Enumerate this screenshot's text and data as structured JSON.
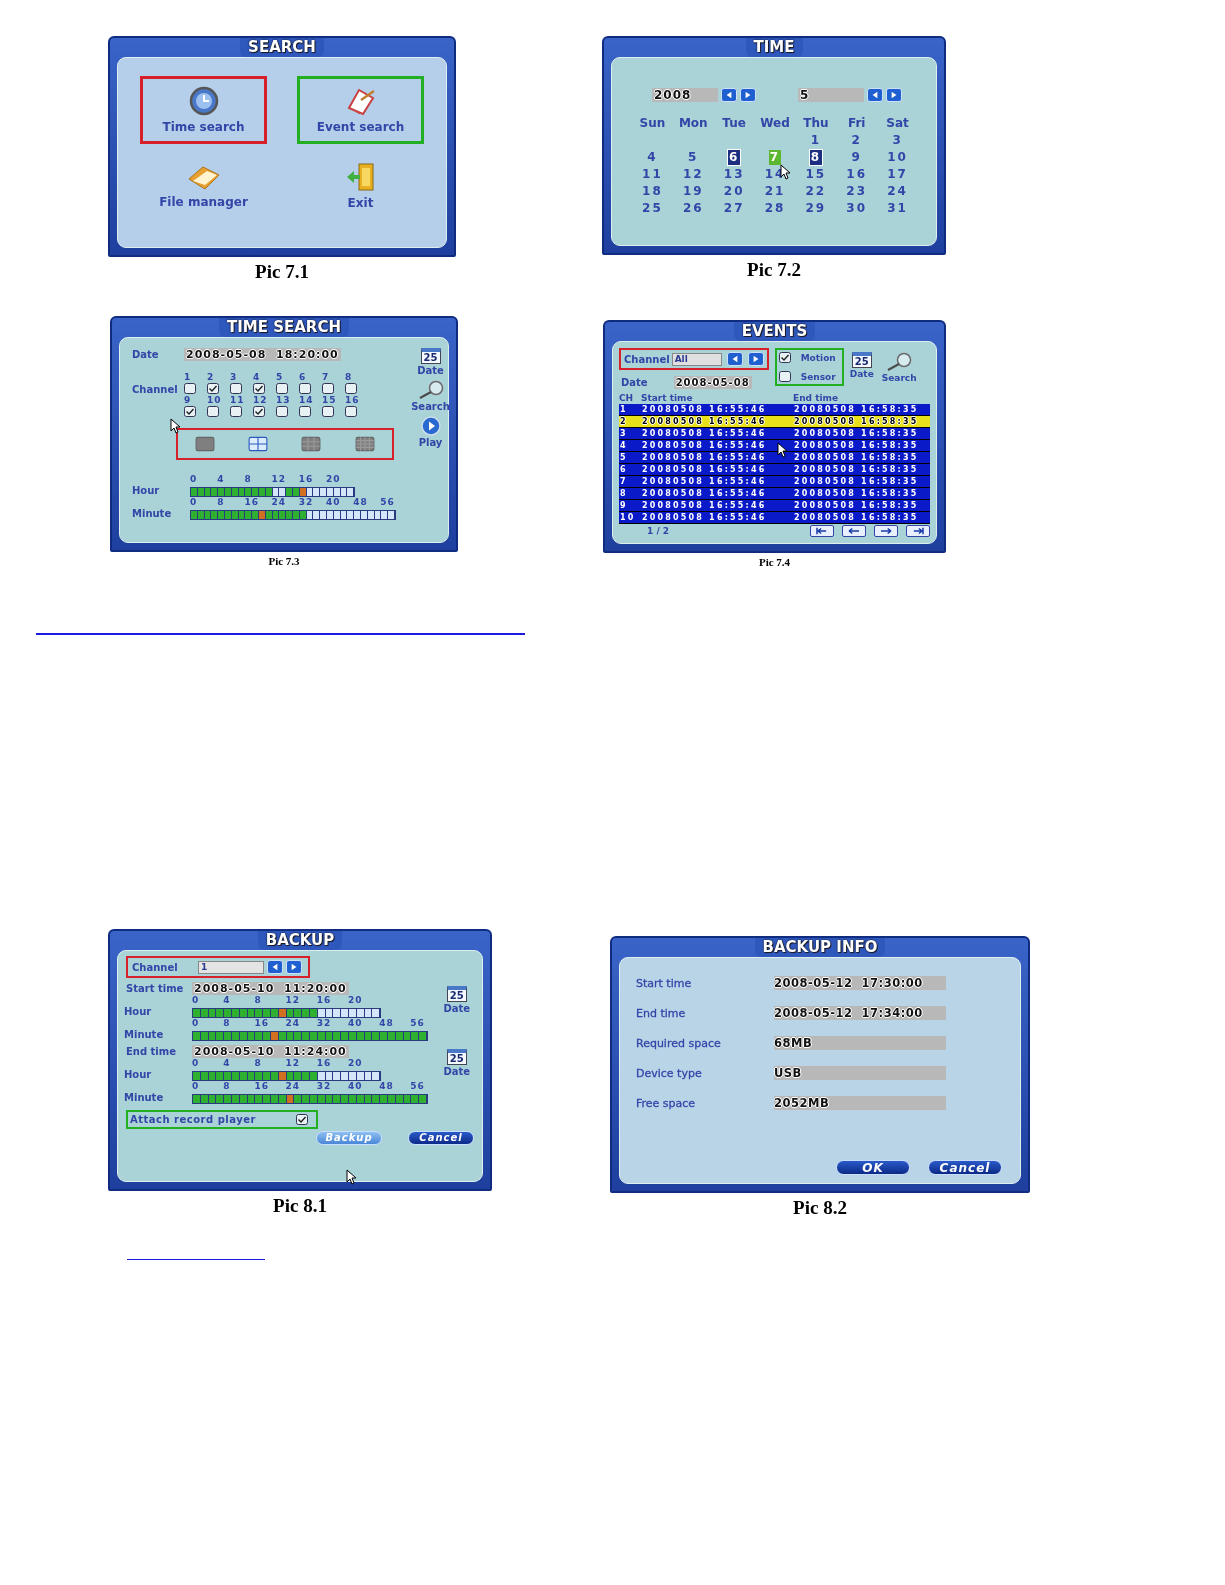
{
  "figures": [
    {
      "kind": "search",
      "title": "SEARCH",
      "caption": "Pic 7.1",
      "items": [
        {
          "label": "Time search",
          "color": "#d8202a"
        },
        {
          "label": "Event search",
          "color": "#22b022"
        },
        {
          "label": "File manager"
        },
        {
          "label": "Exit"
        }
      ]
    },
    {
      "kind": "calendar",
      "title": "TIME",
      "caption": "Pic 7.2",
      "cursor": true,
      "year": "2008",
      "month": "5",
      "weekdays": [
        "Sun",
        "Mon",
        "Tue",
        "Wed",
        "Thu",
        "Fri",
        "Sat"
      ],
      "weeks": [
        {
          "days": [
            {
              "label": "1",
              "marked": false,
              "selected": false
            },
            {
              "label": "2",
              "marked": false,
              "selected": false
            },
            {
              "label": "3",
              "marked": false,
              "selected": false
            }
          ]
        },
        {
          "days": [
            {
              "label": "4",
              "marked": false,
              "selected": false
            },
            {
              "label": "5",
              "marked": false,
              "selected": false
            },
            {
              "label": "6",
              "marked": true,
              "selected": false
            },
            {
              "label": "7",
              "marked": false,
              "selected": true
            },
            {
              "label": "8",
              "marked": true,
              "selected": false
            },
            {
              "label": "9",
              "marked": false,
              "selected": false
            },
            {
              "label": "10",
              "marked": false,
              "selected": false
            }
          ]
        },
        {
          "days": [
            {
              "label": "11",
              "marked": false,
              "selected": false
            },
            {
              "label": "12",
              "marked": false,
              "selected": false
            },
            {
              "label": "13",
              "marked": false,
              "selected": false
            },
            {
              "label": "14",
              "marked": false,
              "selected": false
            },
            {
              "label": "15",
              "marked": false,
              "selected": false
            },
            {
              "label": "16",
              "marked": false,
              "selected": false
            },
            {
              "label": "17",
              "marked": false,
              "selected": false
            }
          ]
        },
        {
          "days": [
            {
              "label": "18",
              "marked": false,
              "selected": false
            },
            {
              "label": "19",
              "marked": false,
              "selected": false
            },
            {
              "label": "20",
              "marked": false,
              "selected": false
            },
            {
              "label": "21",
              "marked": false,
              "selected": false
            },
            {
              "label": "22",
              "marked": false,
              "selected": false
            },
            {
              "label": "23",
              "marked": false,
              "selected": false
            },
            {
              "label": "24",
              "marked": false,
              "selected": false
            }
          ]
        },
        {
          "days": [
            {
              "label": "25",
              "marked": false,
              "selected": false
            },
            {
              "label": "26",
              "marked": false,
              "selected": false
            },
            {
              "label": "27",
              "marked": false,
              "selected": false
            },
            {
              "label": "28",
              "marked": false,
              "selected": false
            },
            {
              "label": "29",
              "marked": false,
              "selected": false
            },
            {
              "label": "30",
              "marked": false,
              "selected": false
            },
            {
              "label": "31",
              "marked": false,
              "selected": false
            }
          ]
        }
      ]
    },
    {
      "kind": "time_search",
      "title": "TIME SEARCH",
      "caption": "Pic 7.3",
      "cursor": true,
      "date_label": "Date",
      "date_value": "2008-05-08  18:20:00",
      "channel_label": "Channel",
      "channels": [
        {
          "label": "1",
          "checked": false
        },
        {
          "label": "2",
          "checked": true
        },
        {
          "label": "3",
          "checked": false
        },
        {
          "label": "4",
          "checked": true
        },
        {
          "label": "5",
          "checked": false
        },
        {
          "label": "6",
          "checked": false
        },
        {
          "label": "7",
          "checked": false
        },
        {
          "label": "8",
          "checked": false
        },
        {
          "label": "9",
          "checked": true
        },
        {
          "label": "10",
          "checked": false
        },
        {
          "label": "11",
          "checked": false
        },
        {
          "label": "12",
          "checked": true
        },
        {
          "label": "13",
          "checked": false
        },
        {
          "label": "14",
          "checked": false
        },
        {
          "label": "15",
          "checked": false
        },
        {
          "label": "16",
          "checked": false
        }
      ],
      "layouts": [
        {
          "selected": false
        },
        {
          "selected": true
        },
        {
          "selected": false
        },
        {
          "selected": false
        }
      ],
      "side_buttons": [
        {
          "label": "Date",
          "icon_text": "25"
        },
        {
          "label": "Search"
        },
        {
          "label": "Play"
        }
      ],
      "timelines": [
        {
          "label": "Hour",
          "ticks": [
            "0",
            "4",
            "8",
            "12",
            "16",
            "20"
          ],
          "cells": [
            {
              "kind": "recorded"
            },
            {
              "kind": "recorded"
            },
            {
              "kind": "recorded"
            },
            {
              "kind": "recorded"
            },
            {
              "kind": "recorded"
            },
            {
              "kind": "recorded"
            },
            {
              "kind": "recorded"
            },
            {
              "kind": "recorded"
            },
            {
              "kind": "recorded"
            },
            {
              "kind": "recorded"
            },
            {
              "kind": "recorded"
            },
            {
              "kind": "recorded"
            },
            {
              "kind": "empty"
            },
            {
              "kind": "empty"
            },
            {
              "kind": "recorded"
            },
            {
              "kind": "recorded"
            },
            {
              "kind": "current"
            },
            {
              "kind": "empty"
            },
            {
              "kind": "empty"
            },
            {
              "kind": "empty"
            },
            {
              "kind": "empty"
            },
            {
              "kind": "empty"
            },
            {
              "kind": "empty"
            },
            {
              "kind": "empty"
            }
          ]
        },
        {
          "label": "Minute",
          "ticks": [
            "0",
            "8",
            "16",
            "24",
            "32",
            "40",
            "48",
            "56"
          ],
          "cells": [
            {
              "kind": "recorded"
            },
            {
              "kind": "recorded"
            },
            {
              "kind": "recorded"
            },
            {
              "kind": "recorded"
            },
            {
              "kind": "recorded"
            },
            {
              "kind": "recorded"
            },
            {
              "kind": "recorded"
            },
            {
              "kind": "recorded"
            },
            {
              "kind": "recorded"
            },
            {
              "kind": "recorded"
            },
            {
              "kind": "current"
            },
            {
              "kind": "recorded"
            },
            {
              "kind": "recorded"
            },
            {
              "kind": "recorded"
            },
            {
              "kind": "recorded"
            },
            {
              "kind": "recorded"
            },
            {
              "kind": "recorded"
            },
            {
              "kind": "empty"
            },
            {
              "kind": "empty"
            },
            {
              "kind": "empty"
            },
            {
              "kind": "empty"
            },
            {
              "kind": "empty"
            },
            {
              "kind": "empty"
            },
            {
              "kind": "empty"
            },
            {
              "kind": "empty"
            },
            {
              "kind": "empty"
            },
            {
              "kind": "empty"
            },
            {
              "kind": "empty"
            },
            {
              "kind": "empty"
            },
            {
              "kind": "empty"
            }
          ]
        }
      ]
    },
    {
      "kind": "events",
      "title": "EVENTS",
      "caption": "Pic 7.4",
      "cursor": true,
      "channel": {
        "label": "Channel",
        "value": "All",
        "color": "#d8202a"
      },
      "date_label": "Date",
      "date_value": "2008-05-08",
      "filters": {
        "color": "#22b022",
        "items": [
          {
            "label": "Motion",
            "checked": true
          },
          {
            "label": "Sensor",
            "checked": false
          }
        ]
      },
      "buttons": [
        {
          "label": "Date",
          "icon_text": "25"
        },
        {
          "label": "Search"
        }
      ],
      "columns": [
        "CH",
        "Start time",
        "End time"
      ],
      "rows": [
        {
          "cells": [
            "1",
            "20080508  16:55:46",
            "20080508  16:58:35"
          ],
          "selected": false
        },
        {
          "cells": [
            "2",
            "20080508  16:55:46",
            "20080508  16:58:35"
          ],
          "selected": true
        },
        {
          "cells": [
            "3",
            "20080508  16:55:46",
            "20080508  16:58:35"
          ],
          "selected": false
        },
        {
          "cells": [
            "4",
            "20080508  16:55:46",
            "20080508  16:58:35"
          ],
          "selected": false
        },
        {
          "cells": [
            "5",
            "20080508  16:55:46",
            "20080508  16:58:35"
          ],
          "selected": false
        },
        {
          "cells": [
            "6",
            "20080508  16:55:46",
            "20080508  16:58:35"
          ],
          "selected": false
        },
        {
          "cells": [
            "7",
            "20080508  16:55:46",
            "20080508  16:58:35"
          ],
          "selected": false
        },
        {
          "cells": [
            "8",
            "20080508  16:55:46",
            "20080508  16:58:35"
          ],
          "selected": false
        },
        {
          "cells": [
            "9",
            "20080508  16:55:46",
            "20080508  16:58:35"
          ],
          "selected": false
        },
        {
          "cells": [
            "10",
            "20080508  16:55:46",
            "20080508  16:58:35"
          ],
          "selected": false
        }
      ],
      "page": "1 / 2"
    },
    {
      "kind": "backup",
      "title": "BACKUP",
      "caption": "Pic 8.1",
      "cursor": true,
      "channel": {
        "label": "Channel",
        "value": "1",
        "color": "#d8202a"
      },
      "ranges": [
        {
          "label": "Start time",
          "value": "2008-05-10  11:20:00",
          "button": {
            "label": "Date",
            "icon_text": "25"
          },
          "timelines": [
            {
              "label": "Hour",
              "ticks": [
                "0",
                "4",
                "8",
                "12",
                "16",
                "20"
              ],
              "cells": [
                {
                  "kind": "recorded"
                },
                {
                  "kind": "recorded"
                },
                {
                  "kind": "recorded"
                },
                {
                  "kind": "recorded"
                },
                {
                  "kind": "recorded"
                },
                {
                  "kind": "recorded"
                },
                {
                  "kind": "recorded"
                },
                {
                  "kind": "recorded"
                },
                {
                  "kind": "recorded"
                },
                {
                  "kind": "recorded"
                },
                {
                  "kind": "recorded"
                },
                {
                  "kind": "current"
                },
                {
                  "kind": "recorded"
                },
                {
                  "kind": "recorded"
                },
                {
                  "kind": "recorded"
                },
                {
                  "kind": "recorded"
                },
                {
                  "kind": "empty"
                },
                {
                  "kind": "empty"
                },
                {
                  "kind": "empty"
                },
                {
                  "kind": "empty"
                },
                {
                  "kind": "empty"
                },
                {
                  "kind": "empty"
                },
                {
                  "kind": "empty"
                },
                {
                  "kind": "empty"
                }
              ]
            },
            {
              "label": "Minute",
              "ticks": [
                "0",
                "8",
                "16",
                "24",
                "32",
                "40",
                "48",
                "56"
              ],
              "cells": [
                {
                  "kind": "recorded"
                },
                {
                  "kind": "recorded"
                },
                {
                  "kind": "recorded"
                },
                {
                  "kind": "recorded"
                },
                {
                  "kind": "recorded"
                },
                {
                  "kind": "recorded"
                },
                {
                  "kind": "recorded"
                },
                {
                  "kind": "recorded"
                },
                {
                  "kind": "recorded"
                },
                {
                  "kind": "recorded"
                },
                {
                  "kind": "current"
                },
                {
                  "kind": "recorded"
                },
                {
                  "kind": "recorded"
                },
                {
                  "kind": "recorded"
                },
                {
                  "kind": "recorded"
                },
                {
                  "kind": "recorded"
                },
                {
                  "kind": "recorded"
                },
                {
                  "kind": "recorded"
                },
                {
                  "kind": "recorded"
                },
                {
                  "kind": "recorded"
                },
                {
                  "kind": "recorded"
                },
                {
                  "kind": "recorded"
                },
                {
                  "kind": "recorded"
                },
                {
                  "kind": "recorded"
                },
                {
                  "kind": "recorded"
                },
                {
                  "kind": "recorded"
                },
                {
                  "kind": "recorded"
                },
                {
                  "kind": "recorded"
                },
                {
                  "kind": "recorded"
                },
                {
                  "kind": "recorded"
                }
              ]
            }
          ]
        },
        {
          "label": "End time",
          "value": "2008-05-10  11:24:00",
          "button": {
            "label": "Date",
            "icon_text": "25"
          },
          "timelines": [
            {
              "label": "Hour",
              "ticks": [
                "0",
                "4",
                "8",
                "12",
                "16",
                "20"
              ],
              "cells": [
                {
                  "kind": "recorded"
                },
                {
                  "kind": "recorded"
                },
                {
                  "kind": "recorded"
                },
                {
                  "kind": "recorded"
                },
                {
                  "kind": "recorded"
                },
                {
                  "kind": "recorded"
                },
                {
                  "kind": "recorded"
                },
                {
                  "kind": "recorded"
                },
                {
                  "kind": "recorded"
                },
                {
                  "kind": "recorded"
                },
                {
                  "kind": "recorded"
                },
                {
                  "kind": "current"
                },
                {
                  "kind": "recorded"
                },
                {
                  "kind": "recorded"
                },
                {
                  "kind": "recorded"
                },
                {
                  "kind": "recorded"
                },
                {
                  "kind": "empty"
                },
                {
                  "kind": "empty"
                },
                {
                  "kind": "empty"
                },
                {
                  "kind": "empty"
                },
                {
                  "kind": "empty"
                },
                {
                  "kind": "empty"
                },
                {
                  "kind": "empty"
                },
                {
                  "kind": "empty"
                }
              ]
            },
            {
              "label": "Minute",
              "ticks": [
                "0",
                "8",
                "16",
                "24",
                "32",
                "40",
                "48",
                "56"
              ],
              "cells": [
                {
                  "kind": "recorded"
                },
                {
                  "kind": "recorded"
                },
                {
                  "kind": "recorded"
                },
                {
                  "kind": "recorded"
                },
                {
                  "kind": "recorded"
                },
                {
                  "kind": "recorded"
                },
                {
                  "kind": "recorded"
                },
                {
                  "kind": "recorded"
                },
                {
                  "kind": "recorded"
                },
                {
                  "kind": "recorded"
                },
                {
                  "kind": "recorded"
                },
                {
                  "kind": "recorded"
                },
                {
                  "kind": "current"
                },
                {
                  "kind": "recorded"
                },
                {
                  "kind": "recorded"
                },
                {
                  "kind": "recorded"
                },
                {
                  "kind": "recorded"
                },
                {
                  "kind": "recorded"
                },
                {
                  "kind": "recorded"
                },
                {
                  "kind": "recorded"
                },
                {
                  "kind": "recorded"
                },
                {
                  "kind": "recorded"
                },
                {
                  "kind": "recorded"
                },
                {
                  "kind": "recorded"
                },
                {
                  "kind": "recorded"
                },
                {
                  "kind": "recorded"
                },
                {
                  "kind": "recorded"
                },
                {
                  "kind": "recorded"
                },
                {
                  "kind": "recorded"
                },
                {
                  "kind": "recorded"
                }
              ]
            }
          ]
        }
      ],
      "attach": {
        "label": "Attach record player",
        "checked": true,
        "color": "#22b022"
      },
      "buttons": [
        {
          "label": "Backup",
          "selected": true
        },
        {
          "label": "Cancel",
          "selected": false
        }
      ]
    },
    {
      "kind": "backup_info",
      "title": "BACKUP INFO",
      "caption": "Pic 8.2",
      "rows": [
        {
          "label": "Start time",
          "value": "2008-05-12  17:30:00"
        },
        {
          "label": "End time",
          "value": "2008-05-12  17:34:00"
        },
        {
          "label": "Required space",
          "value": "68MB"
        },
        {
          "label": "Device type",
          "value": "USB"
        },
        {
          "label": "Free space",
          "value": "2052MB"
        }
      ],
      "buttons": [
        {
          "label": "OK",
          "selected": false
        },
        {
          "label": "Cancel",
          "selected": false
        }
      ]
    }
  ]
}
